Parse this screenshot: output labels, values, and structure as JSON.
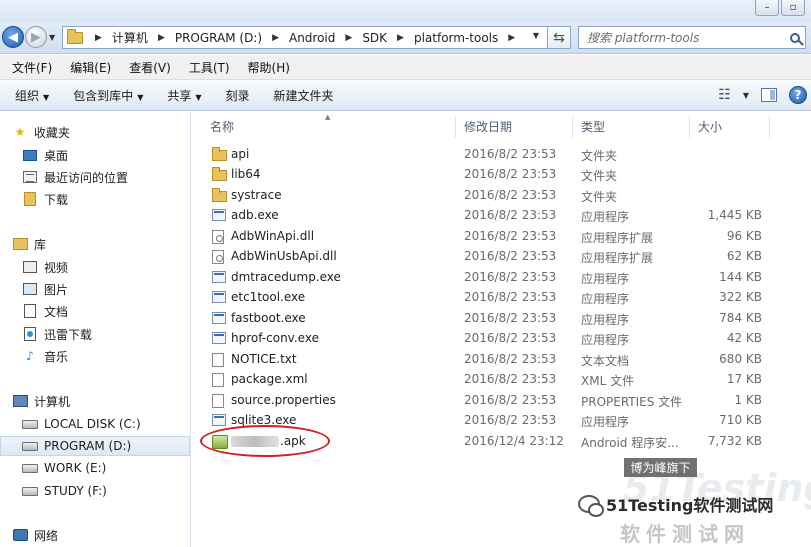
{
  "address": {
    "breadcrumbs": [
      "计算机",
      "PROGRAM (D:)",
      "Android",
      "SDK",
      "platform-tools"
    ]
  },
  "search": {
    "placeholder": "搜索 platform-tools"
  },
  "menu": [
    "文件(F)",
    "编辑(E)",
    "查看(V)",
    "工具(T)",
    "帮助(H)"
  ],
  "commands": {
    "organize": "组织",
    "include_in_library": "包含到库中",
    "share": "共享",
    "burn": "刻录",
    "new_folder": "新建文件夹"
  },
  "sidebar": {
    "favorites": "收藏夹",
    "desktop": "桌面",
    "recent": "最近访问的位置",
    "downloads": "下载",
    "libraries": "库",
    "videos": "视频",
    "pictures": "图片",
    "documents": "文档",
    "xunlei": "迅雷下载",
    "music": "音乐",
    "computer": "计算机",
    "drive_c": "LOCAL DISK (C:)",
    "drive_d": "PROGRAM (D:)",
    "drive_e": "WORK (E:)",
    "drive_f": "STUDY (F:)",
    "network": "网络"
  },
  "columns": {
    "name": "名称",
    "date": "修改日期",
    "type": "类型",
    "size": "大小"
  },
  "files": [
    {
      "name": "api",
      "date": "2016/8/2 23:53",
      "type": "文件夹",
      "size": "",
      "icon": "folder"
    },
    {
      "name": "lib64",
      "date": "2016/8/2 23:53",
      "type": "文件夹",
      "size": "",
      "icon": "folder"
    },
    {
      "name": "systrace",
      "date": "2016/8/2 23:53",
      "type": "文件夹",
      "size": "",
      "icon": "folder"
    },
    {
      "name": "adb.exe",
      "date": "2016/8/2 23:53",
      "type": "应用程序",
      "size": "1,445 KB",
      "icon": "exe"
    },
    {
      "name": "AdbWinApi.dll",
      "date": "2016/8/2 23:53",
      "type": "应用程序扩展",
      "size": "96 KB",
      "icon": "dll"
    },
    {
      "name": "AdbWinUsbApi.dll",
      "date": "2016/8/2 23:53",
      "type": "应用程序扩展",
      "size": "62 KB",
      "icon": "dll"
    },
    {
      "name": "dmtracedump.exe",
      "date": "2016/8/2 23:53",
      "type": "应用程序",
      "size": "144 KB",
      "icon": "exe"
    },
    {
      "name": "etc1tool.exe",
      "date": "2016/8/2 23:53",
      "type": "应用程序",
      "size": "322 KB",
      "icon": "exe"
    },
    {
      "name": "fastboot.exe",
      "date": "2016/8/2 23:53",
      "type": "应用程序",
      "size": "784 KB",
      "icon": "exe"
    },
    {
      "name": "hprof-conv.exe",
      "date": "2016/8/2 23:53",
      "type": "应用程序",
      "size": "42 KB",
      "icon": "exe"
    },
    {
      "name": "NOTICE.txt",
      "date": "2016/8/2 23:53",
      "type": "文本文档",
      "size": "680 KB",
      "icon": "txt"
    },
    {
      "name": "package.xml",
      "date": "2016/8/2 23:53",
      "type": "XML 文件",
      "size": "17 KB",
      "icon": "txt"
    },
    {
      "name": "source.properties",
      "date": "2016/8/2 23:53",
      "type": "PROPERTIES 文件",
      "size": "1 KB",
      "icon": "txt"
    },
    {
      "name": "sqlite3.exe",
      "date": "2016/8/2 23:53",
      "type": "应用程序",
      "size": "710 KB",
      "icon": "exe"
    },
    {
      "name": ".apk",
      "date": "2016/12/4 23:12",
      "type": "Android 程序安...",
      "size": "7,732 KB",
      "icon": "apk"
    }
  ],
  "watermark": {
    "tag": "博为峰旗下",
    "main": "51Testing软件测试网",
    "sub": "软件测试网",
    "big": "51Testing"
  }
}
